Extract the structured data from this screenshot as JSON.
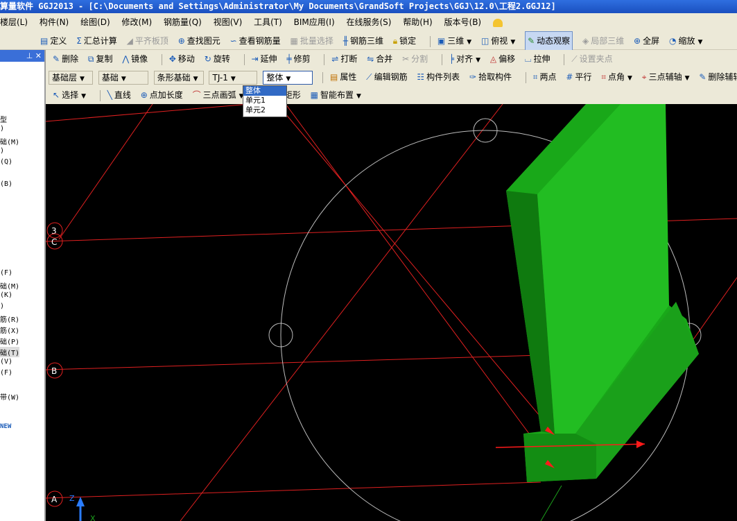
{
  "app": {
    "title": "算量软件 GGJ2013 - [C:\\Documents and Settings\\Administrator\\My Documents\\GrandSoft Projects\\GGJ\\12.0\\工程2.GGJ12]"
  },
  "menu": [
    "楼层(L)",
    "构件(N)",
    "绘图(D)",
    "修改(M)",
    "钢筋量(Q)",
    "视图(V)",
    "工具(T)",
    "BIM应用(I)",
    "在线服务(S)",
    "帮助(H)",
    "版本号(B)"
  ],
  "toolbar1": {
    "items": [
      "定义",
      "汇总计算",
      "平齐板顶",
      "查找图元",
      "查看钢筋量",
      "批量选择",
      "钢筋三维",
      "锁定",
      "三维",
      "俯视",
      "动态观察",
      "局部三维",
      "全屏",
      "缩放"
    ]
  },
  "toolbar2": {
    "items": [
      "删除",
      "复制",
      "镜像",
      "移动",
      "旋转",
      "延伸",
      "修剪",
      "打断",
      "合并",
      "分割",
      "对齐",
      "偏移",
      "拉伸",
      "设置夹点"
    ]
  },
  "toolbar3": {
    "selects": [
      "基础层",
      "基础",
      "条形基础",
      "TJ-1",
      "整体"
    ],
    "items": [
      "属性",
      "编辑钢筋",
      "构件列表",
      "拾取构件",
      "两点",
      "平行",
      "点角",
      "三点辅轴",
      "删除辅轴"
    ]
  },
  "toolbar4": {
    "items": [
      "选择",
      "直线",
      "点加长度",
      "三点画弧",
      "矩形",
      "智能布置"
    ]
  },
  "dropdown": {
    "options": [
      "整体",
      "单元1",
      "单元2"
    ],
    "selected": "整体"
  },
  "left_panel": {
    "items": [
      "型",
      ")",
      "础(M)",
      ")",
      "(Q)",
      "(B)",
      "(F)",
      "础(M)",
      "(K)",
      ")",
      "筋(R)",
      "筋(X)",
      "础(P)",
      "础(T)",
      "(V)",
      "(F)",
      "带(W)"
    ],
    "badge": "NEW"
  },
  "axes": {
    "labels": [
      "3",
      "C",
      "B",
      "A"
    ],
    "axis_z": "Z",
    "axis_x": "X"
  }
}
